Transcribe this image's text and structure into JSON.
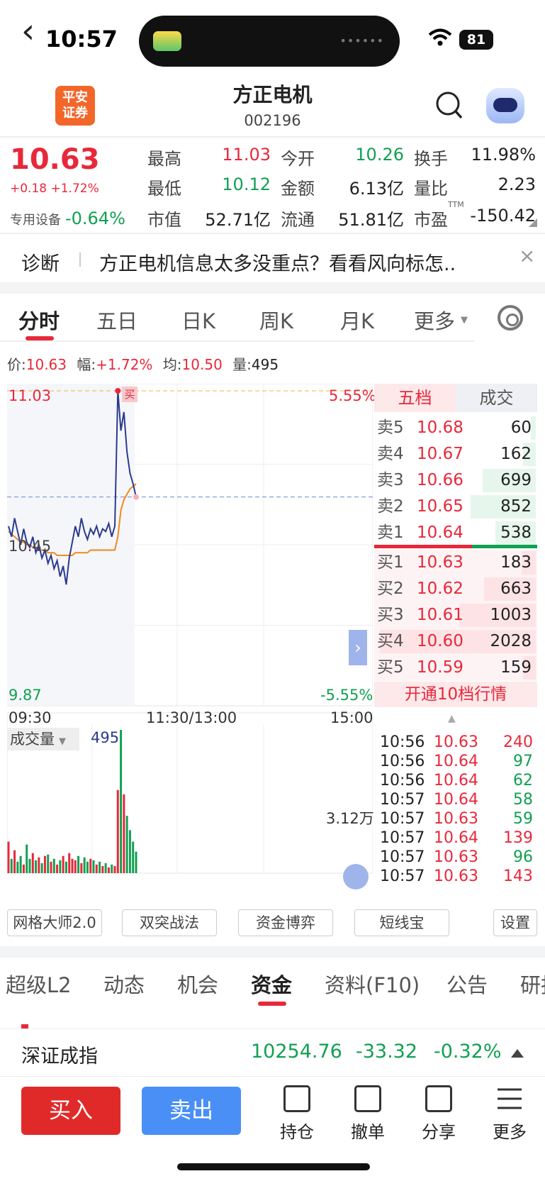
{
  "status": {
    "time": "10:57",
    "battery": "81"
  },
  "header": {
    "title": "方正电机",
    "code": "002196",
    "logo": "平安\n证券"
  },
  "quote": {
    "price": "10.63",
    "change": "+0.18 +1.72%",
    "sector_label": "专用设备",
    "sector_change": "-0.64%",
    "rows": [
      [
        {
          "l": "最高",
          "v": "11.03",
          "c": "red"
        },
        {
          "l": "今开",
          "v": "10.26",
          "c": "green"
        },
        {
          "l": "换手",
          "v": "11.98%",
          "c": "black"
        }
      ],
      [
        {
          "l": "最低",
          "v": "10.12",
          "c": "green"
        },
        {
          "l": "金额",
          "v": "6.13亿",
          "c": "black"
        },
        {
          "l": "量比",
          "v": "2.23",
          "c": "black"
        }
      ],
      [
        {
          "l": "市值",
          "v": "52.71亿",
          "c": "black"
        },
        {
          "l": "流通",
          "v": "51.81亿",
          "c": "black"
        },
        {
          "l": "市盈",
          "sup": "TTM",
          "v": "-150.42",
          "c": "black"
        }
      ]
    ]
  },
  "diagnosis": {
    "tag": "诊断",
    "text": "方正电机信息太多没重点？看看风向标怎..",
    "close": "×"
  },
  "chart_tabs": [
    "分时",
    "五日",
    "日K",
    "周K",
    "月K",
    "更多"
  ],
  "info_bar": {
    "price_label": "价:",
    "price": "10.63",
    "amp_label": "幅:",
    "amp": "+1.72%",
    "avg_label": "均:",
    "avg": "10.50",
    "vol_label": "量:",
    "vol": "495"
  },
  "chart_data": {
    "type": "line",
    "ylim": [
      9.87,
      11.03
    ],
    "ytick_top": "11.03",
    "ytick_mid": "10.45",
    "ytick_bottom": "9.87",
    "pct_top": "5.55%",
    "pct_bottom": "-5.55%",
    "x_labels": [
      "09:30",
      "11:30/13:00",
      "15:00"
    ],
    "buy_marker": "买",
    "price": [
      10.52,
      10.48,
      10.55,
      10.5,
      10.45,
      10.51,
      10.46,
      10.44,
      10.48,
      10.42,
      10.45,
      10.4,
      10.43,
      10.38,
      10.41,
      10.36,
      10.39,
      10.33,
      10.37,
      10.3,
      10.4,
      10.46,
      10.52,
      10.48,
      10.55,
      10.5,
      10.47,
      10.51,
      10.49,
      10.52,
      10.48,
      10.51,
      10.5,
      10.53,
      10.48,
      10.52,
      11.03,
      10.88,
      10.95,
      10.8,
      10.72,
      10.68,
      10.63
    ],
    "avg": [
      10.5,
      10.49,
      10.48,
      10.47,
      10.46,
      10.46,
      10.45,
      10.45,
      10.44,
      10.44,
      10.43,
      10.43,
      10.43,
      10.42,
      10.42,
      10.42,
      10.41,
      10.41,
      10.41,
      10.41,
      10.41,
      10.41,
      10.42,
      10.42,
      10.42,
      10.42,
      10.42,
      10.43,
      10.43,
      10.43,
      10.43,
      10.43,
      10.43,
      10.43,
      10.43,
      10.43,
      10.48,
      10.58,
      10.62,
      10.64,
      10.66,
      10.67,
      10.68
    ],
    "volume_label": "成交量",
    "volume": "495",
    "vol_max_label": "3.12万",
    "vol_bars": [
      0.22,
      0.1,
      0.16,
      0.08,
      0.12,
      0.06,
      0.2,
      0.1,
      0.14,
      0.09,
      0.11,
      0.07,
      0.12,
      0.13,
      0.08,
      0.1,
      0.06,
      0.09,
      0.12,
      0.08,
      0.14,
      0.1,
      0.09,
      0.12,
      0.07,
      0.11,
      0.08,
      0.1,
      0.09,
      0.06,
      0.08,
      0.05,
      0.07,
      0.04,
      0.06,
      0.05,
      0.58,
      1.0,
      0.55,
      0.4,
      0.3,
      0.22,
      0.15
    ]
  },
  "orderbook": {
    "tabs": [
      "五档",
      "成交"
    ],
    "sells": [
      {
        "l": "卖5",
        "p": "10.68",
        "v": "60",
        "w": 0.03
      },
      {
        "l": "卖4",
        "p": "10.67",
        "v": "162",
        "w": 0.08
      },
      {
        "l": "卖3",
        "p": "10.66",
        "v": "699",
        "w": 0.34
      },
      {
        "l": "卖2",
        "p": "10.65",
        "v": "852",
        "w": 0.42
      },
      {
        "l": "卖1",
        "p": "10.64",
        "v": "538",
        "w": 0.26
      }
    ],
    "buys": [
      {
        "l": "买1",
        "p": "10.63",
        "v": "183",
        "w": 0.09
      },
      {
        "l": "买2",
        "p": "10.62",
        "v": "663",
        "w": 0.33
      },
      {
        "l": "买3",
        "p": "10.61",
        "v": "1003",
        "w": 0.49
      },
      {
        "l": "买4",
        "p": "10.60",
        "v": "2028",
        "w": 1.0
      },
      {
        "l": "买5",
        "p": "10.59",
        "v": "159",
        "w": 0.08
      }
    ],
    "open10": "开通10档行情",
    "trades": [
      {
        "t": "10:56",
        "p": "10.63",
        "v": "240"
      },
      {
        "t": "10:56",
        "p": "10.64",
        "v": "97"
      },
      {
        "t": "10:56",
        "p": "10.64",
        "v": "62"
      },
      {
        "t": "10:57",
        "p": "10.64",
        "v": "58"
      },
      {
        "t": "10:57",
        "p": "10.63",
        "v": "59"
      },
      {
        "t": "10:57",
        "p": "10.64",
        "v": "139"
      },
      {
        "t": "10:57",
        "p": "10.63",
        "v": "96"
      },
      {
        "t": "10:57",
        "p": "10.63",
        "v": "143"
      }
    ]
  },
  "tools": [
    "网格大师2.0",
    "双突战法",
    "资金博弈",
    "短线宝",
    "设置"
  ],
  "bottom_tabs": [
    "超级L2",
    "动态",
    "机会",
    "资金",
    "资料(F10)",
    "公告",
    "研报"
  ],
  "index": {
    "name": "深证成指",
    "value": "10254.76",
    "change": "-33.32",
    "pct": "-0.32%"
  },
  "actions": {
    "buy": "买入",
    "sell": "卖出",
    "items": [
      "持仓",
      "撤单",
      "分享",
      "更多"
    ]
  },
  "colors": {
    "up": "#e8283a",
    "down": "#12a052",
    "price_line": "#2b3a8f",
    "avg_line": "#f08a1c"
  }
}
